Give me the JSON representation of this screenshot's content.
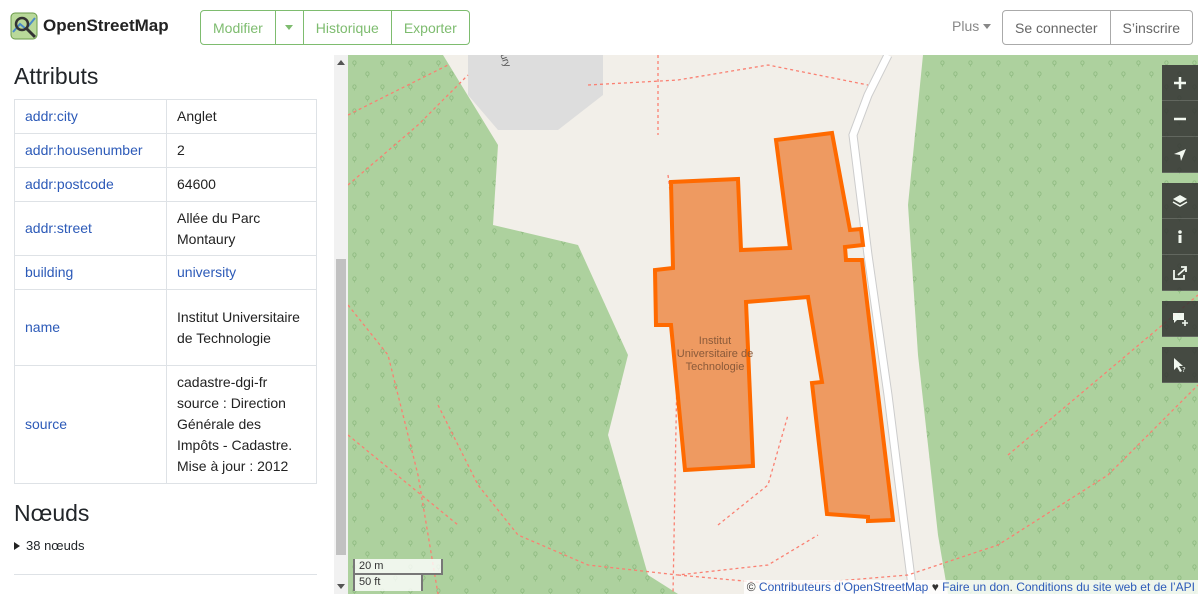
{
  "header": {
    "logo_text": "OpenStreetMap",
    "edit_label": "Modifier",
    "history_label": "Historique",
    "export_label": "Exporter",
    "more_label": "Plus",
    "login_label": "Se connecter",
    "signup_label": "S’inscrire"
  },
  "sidebar": {
    "attributes_title": "Attributs",
    "tags": [
      {
        "key": "addr:city",
        "value": "Anglet"
      },
      {
        "key": "addr:housenumber",
        "value": "2"
      },
      {
        "key": "addr:postcode",
        "value": "64600"
      },
      {
        "key": "addr:street",
        "value": "Allée du Parc Montaury"
      },
      {
        "key": "building",
        "value": "university"
      },
      {
        "key": "name",
        "value": "Institut Universitaire de Technologie"
      },
      {
        "key": "source",
        "value": "cadastre-dgi-fr source : Direction Générale des Impôts - Cadastre. Mise à jour : 2012"
      }
    ],
    "nodes_title": "Nœuds",
    "nodes_toggle": "38 nœuds"
  },
  "map": {
    "building_label": "Institut Universitaire de Technologie",
    "road_label": "ury",
    "scale_metric": "20 m",
    "scale_imperial": "50 ft",
    "attribution": {
      "prefix": "©",
      "contributors": "Contributeurs d’OpenStreetMap",
      "heart": "♥",
      "donate": "Faire un don",
      "terms": "Conditions du site web et de l’API"
    },
    "controls": [
      "zoom-in-icon",
      "zoom-out-icon",
      "locate-icon",
      "layers-icon",
      "info-icon",
      "share-icon",
      "note-icon",
      "query-icon"
    ]
  },
  "colors": {
    "brand_green": "#7ebc6f",
    "forest": "#aed1a0",
    "land": "#f2efe9",
    "building_fill": "#ee9860",
    "building_stroke": "#ff6a00",
    "link_blue": "#2c5ab8"
  }
}
